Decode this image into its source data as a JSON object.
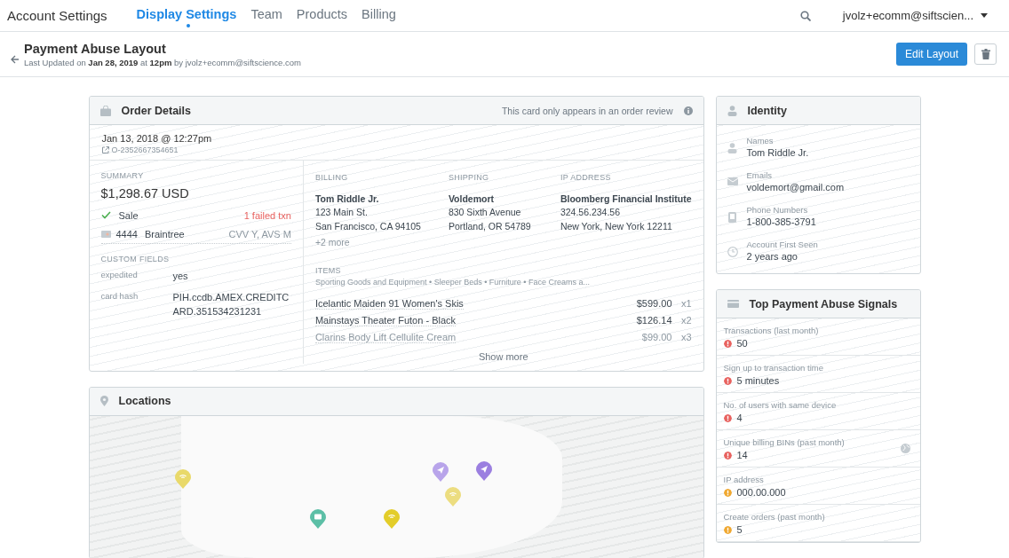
{
  "nav": {
    "title": "Account Settings",
    "tabs": [
      {
        "label": "Display Settings",
        "selected": true
      },
      {
        "label": "Team",
        "selected": false
      },
      {
        "label": "Products",
        "selected": false
      },
      {
        "label": "Billing",
        "selected": false
      }
    ],
    "user": "jvolz+ecomm@siftscien..."
  },
  "header": {
    "title": "Payment Abuse Layout",
    "subtitle": "Last Updated on **Jan 28, 2019** at **12pm** by jvolz+ecomm@siftscience.com",
    "edit_button": "Edit Layout"
  },
  "order_details": {
    "title": "Order Details",
    "note": "This card only appears in an order review",
    "date": "Jan 13, 2018 @ 12:27pm",
    "order_id": "O-2352667354651",
    "summary": {
      "label": "SUMMARY",
      "amount": "$1,298.67 USD",
      "status": "Sale",
      "failed": "1 failed txn",
      "card_last4": "4444",
      "processor": "Braintree",
      "checks": "CVV Y, AVS M"
    },
    "custom_fields": {
      "label": "CUSTOM FIELDS",
      "rows": [
        {
          "key": "expedited",
          "value": "yes"
        },
        {
          "key": "card hash",
          "value": "PIH.ccdb.AMEX.CREDITCARD.351534231231"
        }
      ]
    },
    "addresses": [
      {
        "label": "BILLING",
        "name": "Tom Riddle Jr.",
        "lines": [
          "123 Main St.",
          "San Francisco, CA 94105"
        ],
        "more": "+2 more"
      },
      {
        "label": "SHIPPING",
        "name": "Voldemort",
        "lines": [
          "830 Sixth Avenue",
          "Portland, OR 54789"
        ]
      },
      {
        "label": "IP ADDRESS",
        "name": "Bloomberg Financial Institute",
        "lines": [
          "324.56.234.56",
          "New York, New York 12211"
        ]
      }
    ],
    "items": {
      "label": "ITEMS",
      "categories": "Sporting Goods and Equipment • Sleeper Beds • Furniture • Face Creams a...",
      "rows": [
        {
          "name": "Icelantic Maiden 91 Women's Skis",
          "price": "$599.00",
          "qty": "x1",
          "dimmed": false
        },
        {
          "name": "Mainstays Theater Futon - Black",
          "price": "$126.14",
          "qty": "x2",
          "dimmed": false
        },
        {
          "name": "Clarins Body Lift Cellulite Cream",
          "price": "$99.00",
          "qty": "x3",
          "dimmed": true
        }
      ],
      "show_more": "Show more"
    }
  },
  "locations": {
    "title": "Locations",
    "pins": [
      {
        "kind": "wifi",
        "color": "#e9d96a"
      },
      {
        "kind": "send",
        "color": "#b8a4ea"
      },
      {
        "kind": "send",
        "color": "#9b7fe0"
      },
      {
        "kind": "wifi",
        "color": "#ecdd80"
      },
      {
        "kind": "card",
        "color": "#5cbfa6"
      },
      {
        "kind": "wifi",
        "color": "#e3cd2a"
      }
    ]
  },
  "identity": {
    "title": "Identity",
    "fields": [
      {
        "kind": "person",
        "label": "Names",
        "value": "Tom Riddle Jr."
      },
      {
        "kind": "email",
        "label": "Emails",
        "value": "voldemort@gmail.com"
      },
      {
        "kind": "phone",
        "label": "Phone Numbers",
        "value": "1-800-385-3791"
      },
      {
        "kind": "clock",
        "label": "Account First Seen",
        "value": "2 years ago"
      }
    ]
  },
  "signals": {
    "title": "Top Payment Abuse Signals",
    "rows": [
      {
        "label": "Transactions (last month)",
        "value": "50",
        "color": "#e8625f",
        "globe": false
      },
      {
        "label": "Sign up to transaction time",
        "value": "5 minutes",
        "color": "#e8625f",
        "globe": false
      },
      {
        "label": "No. of users with same device",
        "value": "4",
        "color": "#e8625f",
        "globe": false
      },
      {
        "label": "Unique billing BINs (past month)",
        "value": "14",
        "color": "#e8625f",
        "globe": true
      },
      {
        "label": "IP address",
        "value": "000.00.000",
        "color": "#f0a830",
        "globe": false
      },
      {
        "label": "Create orders (past month)",
        "value": "5",
        "color": "#f0a830",
        "globe": false
      }
    ]
  }
}
